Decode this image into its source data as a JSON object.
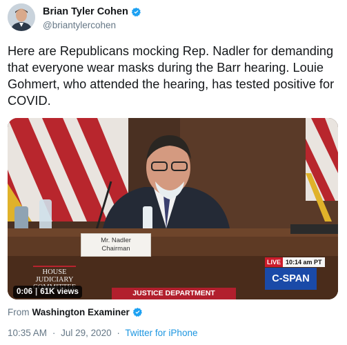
{
  "author": {
    "name": "Brian Tyler Cohen",
    "handle": "@briantylercohen",
    "verified": true
  },
  "tweet": {
    "text": "Here are Republicans mocking Rep. Nadler for demanding that everyone wear masks during the Barr hearing. Louie Gohmert, who attended the hearing, has tested positive for COVID."
  },
  "video": {
    "nameplate_line1": "Mr. Nadler",
    "nameplate_line2": "Chairman",
    "committee_line1": "HOUSE",
    "committee_line2": "JUDICIARY",
    "committee_line3": "COMMITTEE",
    "live_label": "LIVE",
    "live_time": "10:14 am PT",
    "network": "C-SPAN",
    "lower_third": "JUSTICE DEPARTMENT OVERSIGHT",
    "duration": "0:06",
    "views": "61K views"
  },
  "source": {
    "prefix": "From",
    "name": "Washington Examiner",
    "verified": true
  },
  "meta": {
    "time": "10:35 AM",
    "separator": "·",
    "date": "Jul 29, 2020",
    "app": "Twitter for iPhone"
  },
  "colors": {
    "verified_blue": "#1da1f2",
    "link_blue": "#1b95e0",
    "secondary_text": "#657786",
    "live_red": "#cc1b2b",
    "cspan_blue": "#1a4aa8"
  }
}
